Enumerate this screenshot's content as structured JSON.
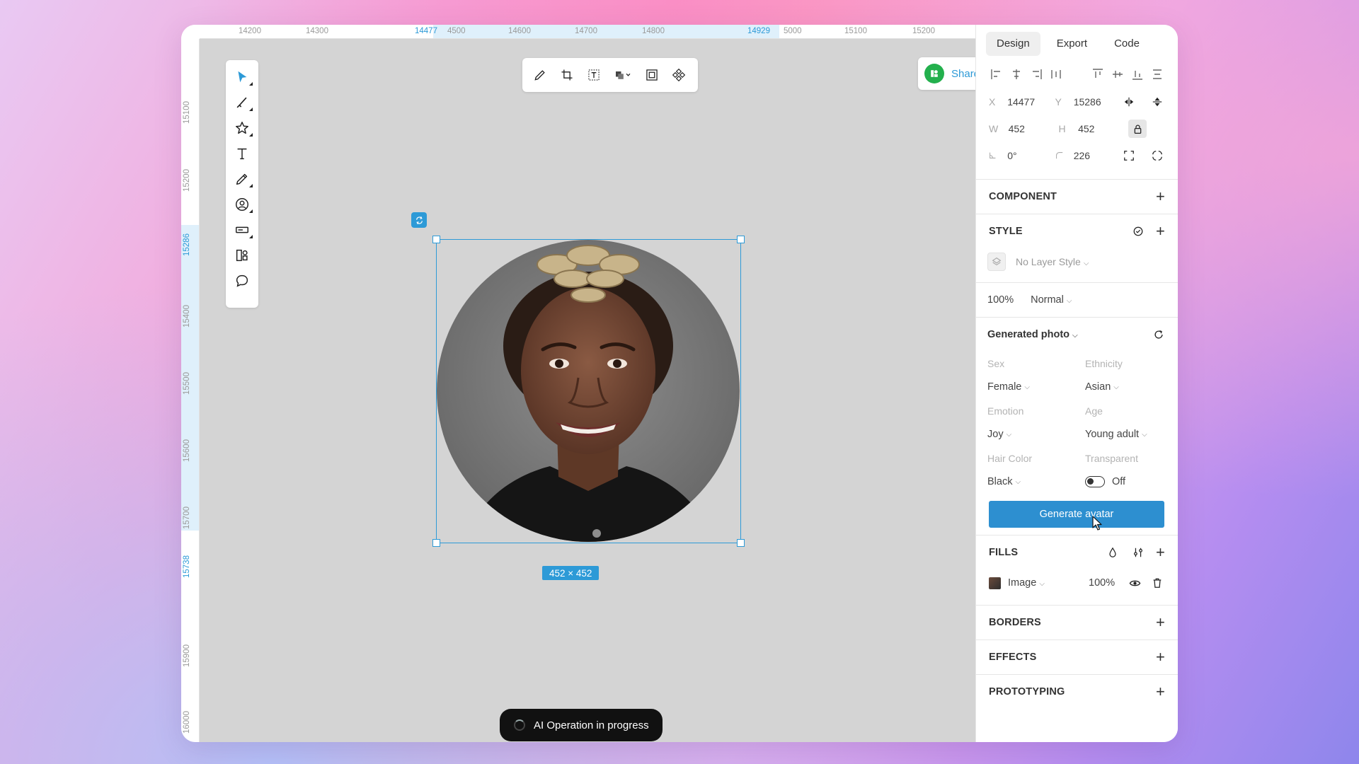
{
  "ruler": {
    "top_labels": [
      "14200",
      "14300",
      "14477",
      "4500",
      "14600",
      "14700",
      "14800",
      "14929",
      "5000",
      "15100",
      "15200"
    ],
    "left_labels": [
      "15100",
      "15200",
      "15286",
      "15400",
      "15500",
      "15600",
      "15700",
      "15738",
      "15900",
      "16000"
    ]
  },
  "left_tools": [
    "select-tool",
    "brush-tool",
    "star-shape-tool",
    "text-tool",
    "pen-tool",
    "avatar-tool",
    "input-tool",
    "component-tool",
    "comment-tool"
  ],
  "top_tools": [
    "edit",
    "crop",
    "text-frame",
    "shapes",
    "frame",
    "component"
  ],
  "share": {
    "label": "Share"
  },
  "selection": {
    "size_label": "452 × 452"
  },
  "ai_status": {
    "label": "AI Operation in progress"
  },
  "panel": {
    "tabs": [
      "Design",
      "Export",
      "Code"
    ],
    "geometry": {
      "x_label": "X",
      "x": "14477",
      "y_label": "Y",
      "y": "15286",
      "w_label": "W",
      "w": "452",
      "h_label": "H",
      "h": "452",
      "rotation": "0°",
      "radius": "226"
    },
    "component": {
      "title": "COMPONENT"
    },
    "style": {
      "title": "STYLE",
      "layer_style": "No Layer Style"
    },
    "opacity": {
      "value": "100%",
      "blend": "Normal"
    },
    "generated_photo": {
      "title": "Generated photo",
      "sex_label": "Sex",
      "sex": "Female",
      "ethnicity_label": "Ethnicity",
      "ethnicity": "Asian",
      "emotion_label": "Emotion",
      "emotion": "Joy",
      "age_label": "Age",
      "age": "Young adult",
      "hair_label": "Hair Color",
      "hair": "Black",
      "transparent_label": "Transparent",
      "transparent": "Off",
      "button": "Generate avatar"
    },
    "fills": {
      "title": "FILLS",
      "type": "Image",
      "opacity": "100%"
    },
    "borders": {
      "title": "BORDERS"
    },
    "effects": {
      "title": "EFFECTS"
    },
    "prototyping": {
      "title": "PROTOTYPING"
    }
  },
  "colors": {
    "accent": "#2d9ad7",
    "button": "#2d8fd0",
    "share_logo": "#23b04d",
    "canvas": "#d4d4d4"
  }
}
